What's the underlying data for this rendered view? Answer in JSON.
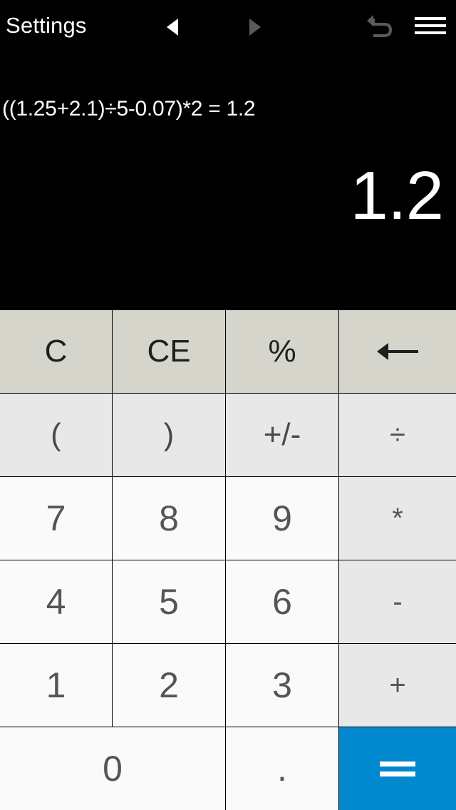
{
  "topbar": {
    "title": "Settings",
    "prev_icon": "triangle-left-icon",
    "next_icon": "triangle-right-icon",
    "undo_icon": "undo-icon",
    "menu_icon": "hamburger-menu-icon",
    "prev_state": "enabled",
    "next_state": "disabled",
    "undo_state": "disabled",
    "menu_state": "enabled"
  },
  "display": {
    "expression": "((1.25+2.1)÷5-0.07)*2 = 1.2",
    "result": "1.2"
  },
  "colors": {
    "background": "#000000",
    "display_text": "#ffffff",
    "func_key_bg": "#d5d5cb",
    "secondary_key_bg": "#e8e8e8",
    "digit_key_bg": "#fafafa",
    "operator_key_bg": "#e8e8e8",
    "equals_bg": "#0288ce",
    "equals_text": "#ffffff",
    "digit_text": "#555555",
    "func_text": "#1f1f1f",
    "divider": "#000000",
    "arrow_active": "#ffffff",
    "arrow_inactive": "#5a5a5a"
  },
  "keypad": {
    "rows": [
      [
        {
          "label": "C",
          "name": "key-clear",
          "kind": "func"
        },
        {
          "label": "CE",
          "name": "key-clear-entry",
          "kind": "func"
        },
        {
          "label": "%",
          "name": "key-percent",
          "kind": "func"
        },
        {
          "label": "←",
          "name": "key-backspace",
          "kind": "func",
          "icon": "arrow-left-icon"
        }
      ],
      [
        {
          "label": "(",
          "name": "key-open-paren",
          "kind": "secondary"
        },
        {
          "label": ")",
          "name": "key-close-paren",
          "kind": "secondary"
        },
        {
          "label": "+/-",
          "name": "key-sign-toggle",
          "kind": "secondary"
        },
        {
          "label": "÷",
          "name": "key-divide",
          "kind": "operator"
        }
      ],
      [
        {
          "label": "7",
          "name": "key-7",
          "kind": "digit"
        },
        {
          "label": "8",
          "name": "key-8",
          "kind": "digit"
        },
        {
          "label": "9",
          "name": "key-9",
          "kind": "digit"
        },
        {
          "label": "*",
          "name": "key-multiply",
          "kind": "operator"
        }
      ],
      [
        {
          "label": "4",
          "name": "key-4",
          "kind": "digit"
        },
        {
          "label": "5",
          "name": "key-5",
          "kind": "digit"
        },
        {
          "label": "6",
          "name": "key-6",
          "kind": "digit"
        },
        {
          "label": "-",
          "name": "key-subtract",
          "kind": "operator"
        }
      ],
      [
        {
          "label": "1",
          "name": "key-1",
          "kind": "digit"
        },
        {
          "label": "2",
          "name": "key-2",
          "kind": "digit"
        },
        {
          "label": "3",
          "name": "key-3",
          "kind": "digit"
        },
        {
          "label": "+",
          "name": "key-add",
          "kind": "operator"
        }
      ],
      [
        {
          "label": "0",
          "name": "key-0",
          "kind": "digit",
          "span": 2
        },
        {
          "label": ".",
          "name": "key-decimal",
          "kind": "dot"
        },
        {
          "label": "=",
          "name": "key-equals",
          "kind": "equals",
          "icon": "equals-icon"
        }
      ]
    ]
  }
}
